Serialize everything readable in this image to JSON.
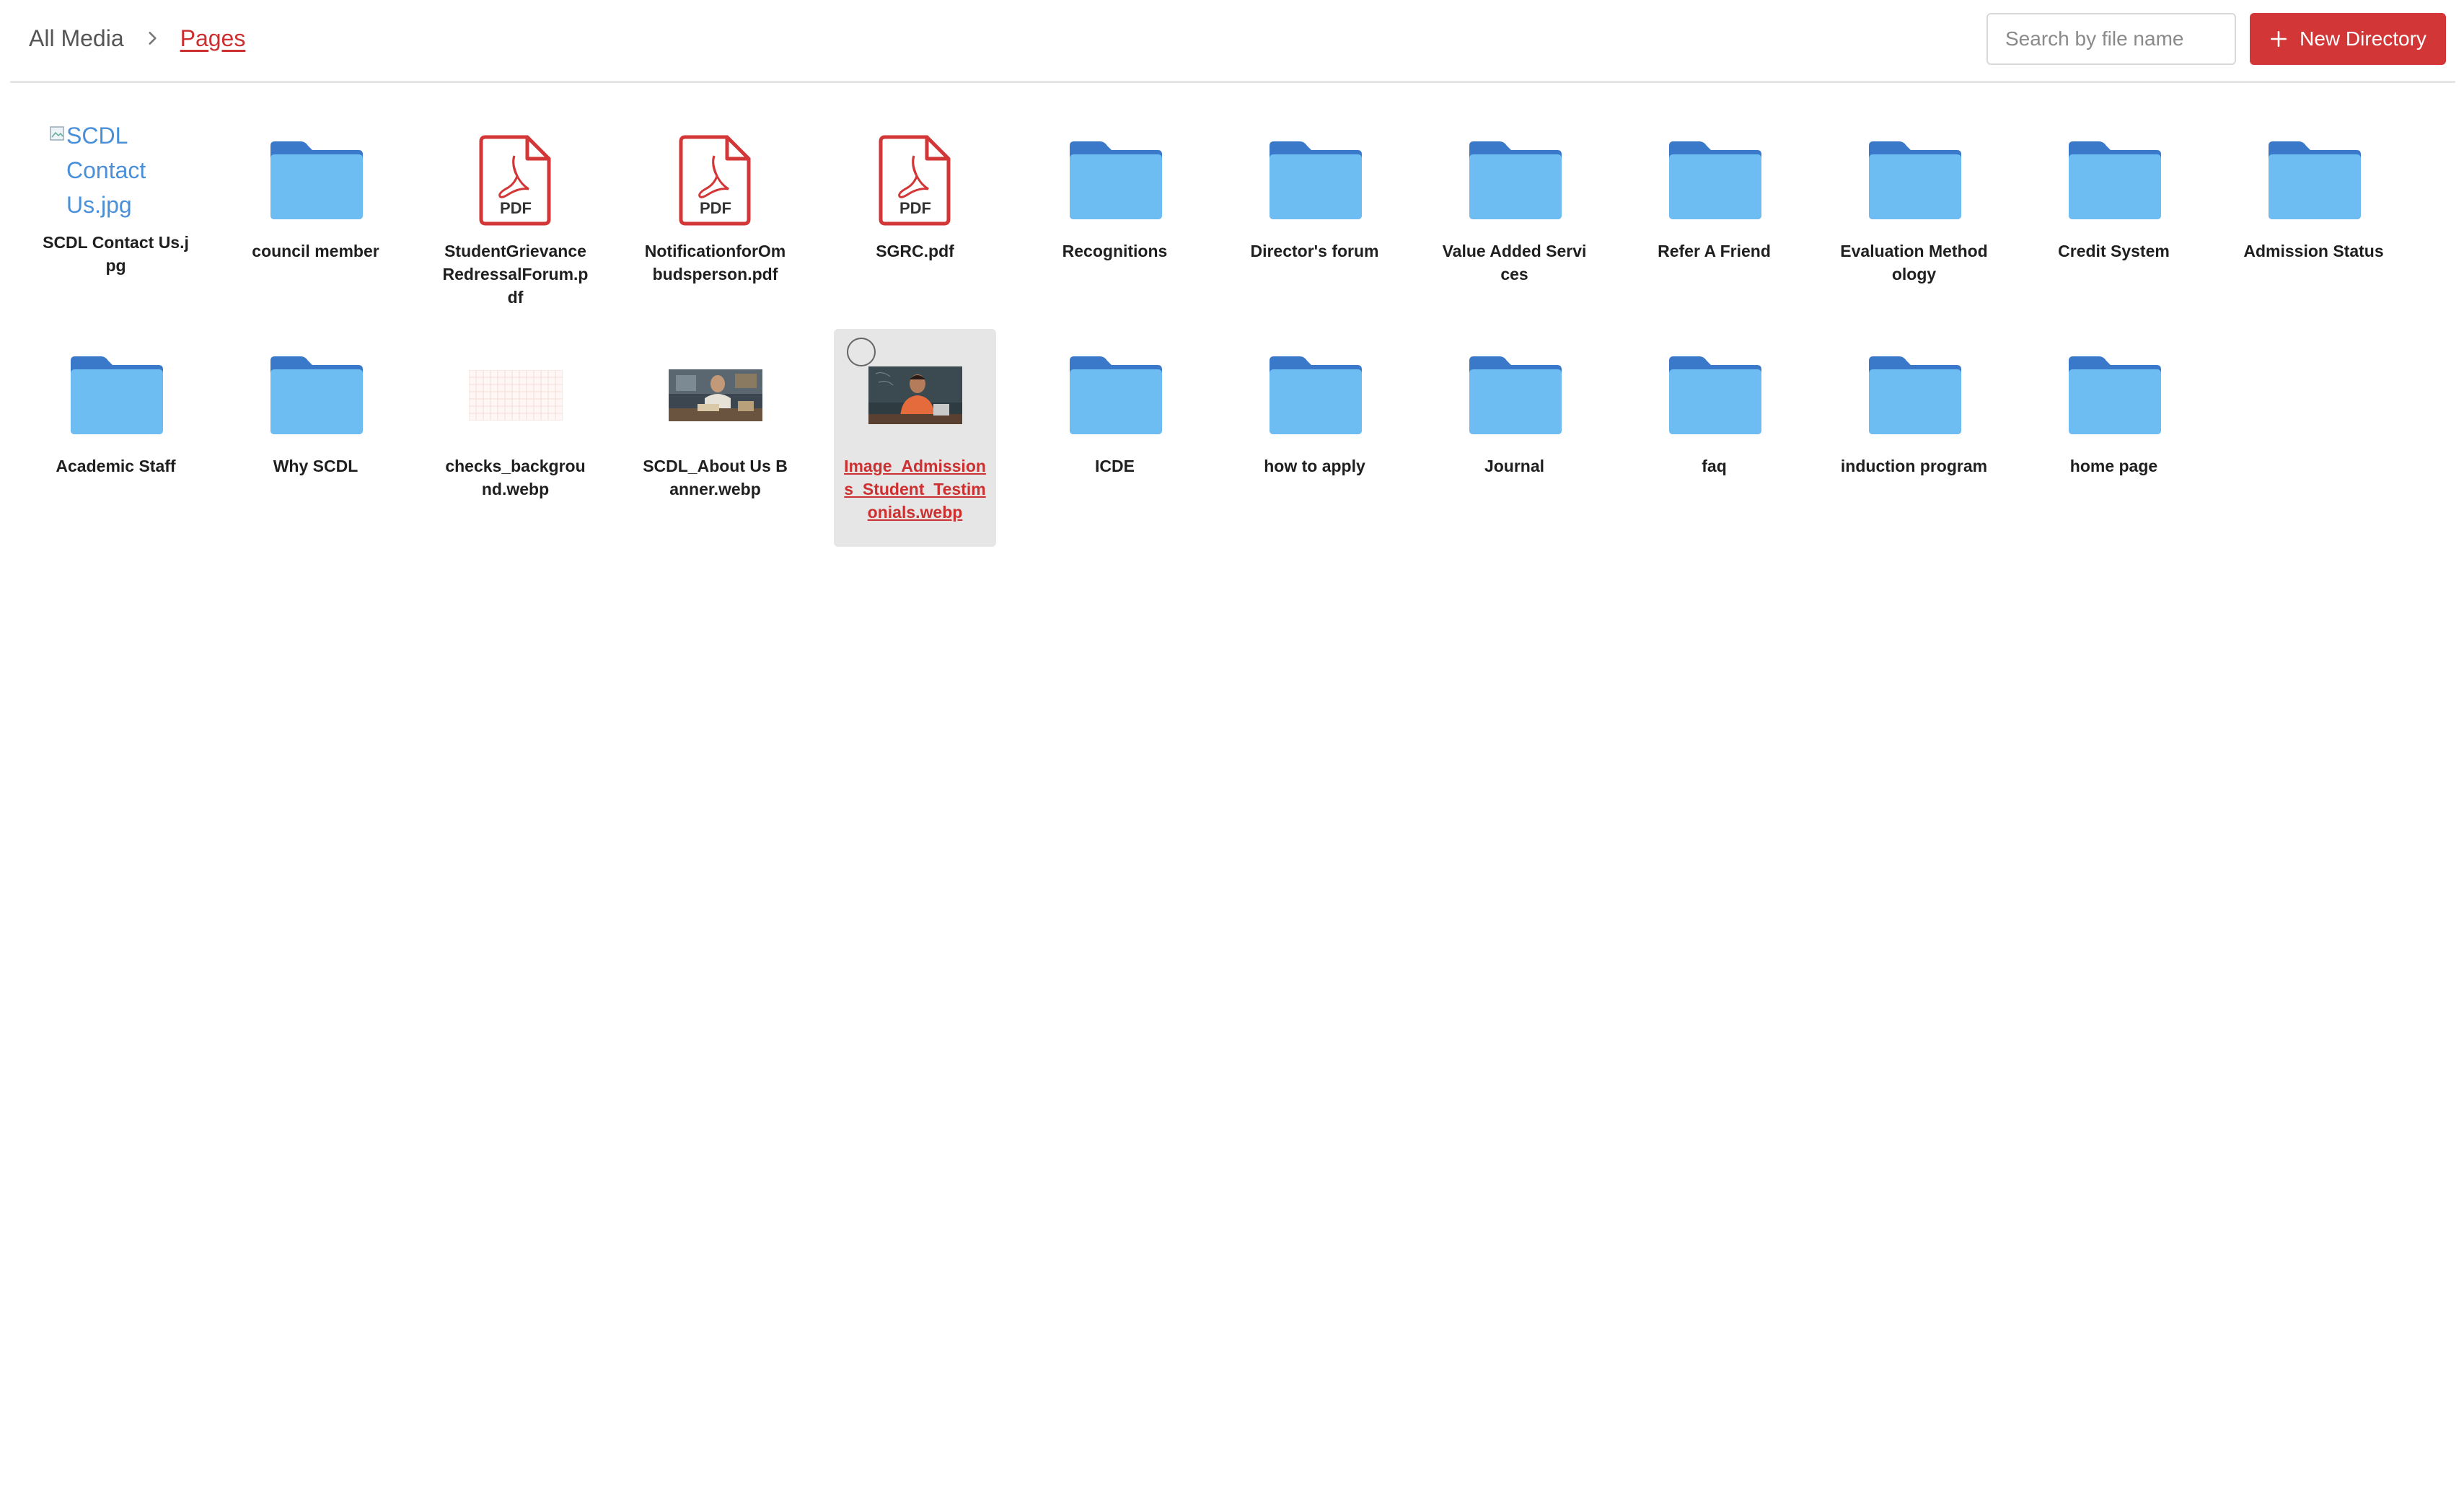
{
  "breadcrumb": {
    "root": "All Media",
    "current": "Pages"
  },
  "search": {
    "placeholder": "Search by file name"
  },
  "new_directory_label": "New Directory",
  "colors": {
    "accent": "#d23636",
    "folder_back": "#3a78c9",
    "folder_front": "#6ebdf2",
    "pdf": "#d23636"
  },
  "items": [
    {
      "name": "SCDL Contact Us.jpg",
      "kind": "broken-image",
      "alt": "SCDL Contact Us.jpg"
    },
    {
      "name": "council member",
      "kind": "folder"
    },
    {
      "name": "StudentGrievanceRedressalForum.pdf",
      "kind": "pdf",
      "badge": "PDF"
    },
    {
      "name": "NotificationforOmbudsperson.pdf",
      "kind": "pdf",
      "badge": "PDF"
    },
    {
      "name": "SGRC.pdf",
      "kind": "pdf",
      "badge": "PDF"
    },
    {
      "name": "Recognitions",
      "kind": "folder"
    },
    {
      "name": "Director's forum",
      "kind": "folder"
    },
    {
      "name": "Value Added Services",
      "kind": "folder"
    },
    {
      "name": "Refer A Friend",
      "kind": "folder"
    },
    {
      "name": "Evaluation Methodology",
      "kind": "folder"
    },
    {
      "name": "Credit System",
      "kind": "folder"
    },
    {
      "name": "Admission Status",
      "kind": "folder"
    },
    {
      "name": "Academic Staff",
      "kind": "folder"
    },
    {
      "name": "Why SCDL",
      "kind": "folder"
    },
    {
      "name": "checks_background.webp",
      "kind": "pattern-image"
    },
    {
      "name": "SCDL_About Us Banner.webp",
      "kind": "photo-desk"
    },
    {
      "name": "Image_Admissions_Student_Testimonials.webp",
      "kind": "photo-person",
      "selected": true
    },
    {
      "name": "ICDE",
      "kind": "folder"
    },
    {
      "name": "how to apply",
      "kind": "folder"
    },
    {
      "name": "Journal",
      "kind": "folder"
    },
    {
      "name": "faq",
      "kind": "folder"
    },
    {
      "name": "induction program",
      "kind": "folder"
    },
    {
      "name": "home page",
      "kind": "folder"
    }
  ]
}
